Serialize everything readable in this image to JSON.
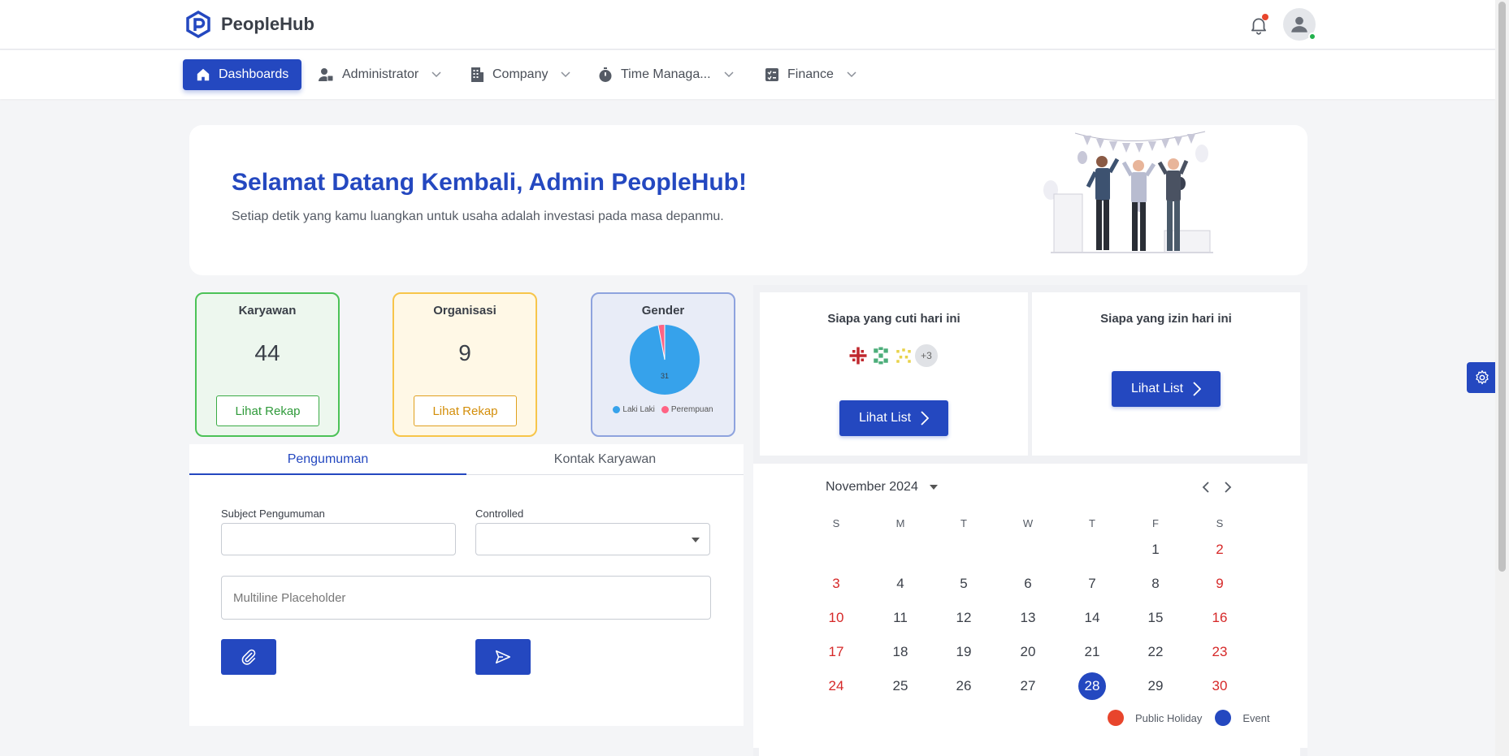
{
  "brand": {
    "name": "PeopleHub"
  },
  "nav": {
    "items": [
      {
        "label": "Dashboards"
      },
      {
        "label": "Administrator"
      },
      {
        "label": "Company"
      },
      {
        "label": "Time Managa..."
      },
      {
        "label": "Finance"
      }
    ]
  },
  "welcome": {
    "title": "Selamat Datang Kembali, Admin PeopleHub!",
    "subtitle": "Setiap detik yang kamu luangkan untuk usaha adalah investasi pada masa depanmu."
  },
  "stats": {
    "karyawan": {
      "title": "Karyawan",
      "value": "44",
      "button": "Lihat Rekap"
    },
    "organisasi": {
      "title": "Organisasi",
      "value": "9",
      "button": "Lihat Rekap"
    },
    "gender": {
      "title": "Gender",
      "pie_label": "31",
      "legend": [
        {
          "label": "Laki Laki",
          "color": "#36a2eb"
        },
        {
          "label": "Perempuan",
          "color": "#ff6384"
        }
      ]
    }
  },
  "announce": {
    "tabs": [
      "Pengumuman",
      "Kontak Karyawan"
    ],
    "subject_label": "Subject Pengumuman",
    "controlled_label": "Controlled",
    "multiline_placeholder": "Multiline Placeholder"
  },
  "leave": {
    "cuti_title": "Siapa yang cuti hari ini",
    "izin_title": "Siapa yang izin hari ini",
    "more_count": "+3",
    "list_button": "Lihat List"
  },
  "calendar": {
    "month": "November 2024",
    "weekdays": [
      "S",
      "M",
      "T",
      "W",
      "T",
      "F",
      "S"
    ],
    "weeks": [
      [
        "",
        "",
        "",
        "",
        "",
        "1",
        "2"
      ],
      [
        "3",
        "4",
        "5",
        "6",
        "7",
        "8",
        "9"
      ],
      [
        "10",
        "11",
        "12",
        "13",
        "14",
        "15",
        "16"
      ],
      [
        "17",
        "18",
        "19",
        "20",
        "21",
        "22",
        "23"
      ],
      [
        "24",
        "25",
        "26",
        "27",
        "28",
        "29",
        "30"
      ]
    ],
    "today": "28",
    "legend": [
      {
        "label": "Public Holiday",
        "color": "#e8452c"
      },
      {
        "label": "Event",
        "color": "#2448c0"
      }
    ]
  },
  "colors": {
    "primary": "#2448c0",
    "holiday": "#d62828"
  }
}
